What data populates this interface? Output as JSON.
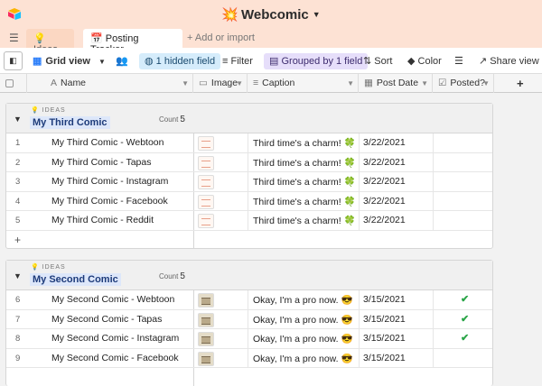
{
  "app": {
    "base_name": "Webcomic",
    "base_emoji": "💥"
  },
  "tabs": [
    {
      "label": "Ideas",
      "emoji": "💡"
    },
    {
      "label": "Posting Tracker",
      "emoji": "📅"
    }
  ],
  "add_import": "Add or import",
  "toolbar": {
    "view_name": "Grid view",
    "hidden": "1 hidden field",
    "filter": "Filter",
    "grouped": "Grouped by 1 field",
    "sort": "Sort",
    "color": "Color",
    "share": "Share view"
  },
  "columns": [
    "Name",
    "Image",
    "Caption",
    "Post Date",
    "Posted?"
  ],
  "groups": [
    {
      "tag": "IDEAS",
      "name": "My Third Comic",
      "count_label": "Count",
      "count": "5",
      "rows": [
        {
          "n": "1",
          "name": "My Third Comic - Webtoon",
          "caption": "Third time's a charm! 🍀",
          "date": "3/22/2021",
          "posted": ""
        },
        {
          "n": "2",
          "name": "My Third Comic - Tapas",
          "caption": "Third time's a charm! 🍀",
          "date": "3/22/2021",
          "posted": ""
        },
        {
          "n": "3",
          "name": "My Third Comic - Instagram",
          "caption": "Third time's a charm! 🍀",
          "date": "3/22/2021",
          "posted": ""
        },
        {
          "n": "4",
          "name": "My Third Comic - Facebook",
          "caption": "Third time's a charm! 🍀",
          "date": "3/22/2021",
          "posted": ""
        },
        {
          "n": "5",
          "name": "My Third Comic - Reddit",
          "caption": "Third time's a charm! 🍀",
          "date": "3/22/2021",
          "posted": ""
        }
      ]
    },
    {
      "tag": "IDEAS",
      "name": "My Second Comic",
      "count_label": "Count",
      "count": "5",
      "rows": [
        {
          "n": "6",
          "name": "My Second Comic - Webtoon",
          "caption": "Okay, I'm a pro now. 😎",
          "date": "3/15/2021",
          "posted": "✔"
        },
        {
          "n": "7",
          "name": "My Second Comic - Tapas",
          "caption": "Okay, I'm a pro now. 😎",
          "date": "3/15/2021",
          "posted": "✔"
        },
        {
          "n": "8",
          "name": "My Second Comic - Instagram",
          "caption": "Okay, I'm a pro now. 😎",
          "date": "3/15/2021",
          "posted": "✔"
        },
        {
          "n": "9",
          "name": "My Second Comic - Facebook",
          "caption": "Okay, I'm a pro now. 😎",
          "date": "3/15/2021",
          "posted": ""
        }
      ]
    }
  ]
}
